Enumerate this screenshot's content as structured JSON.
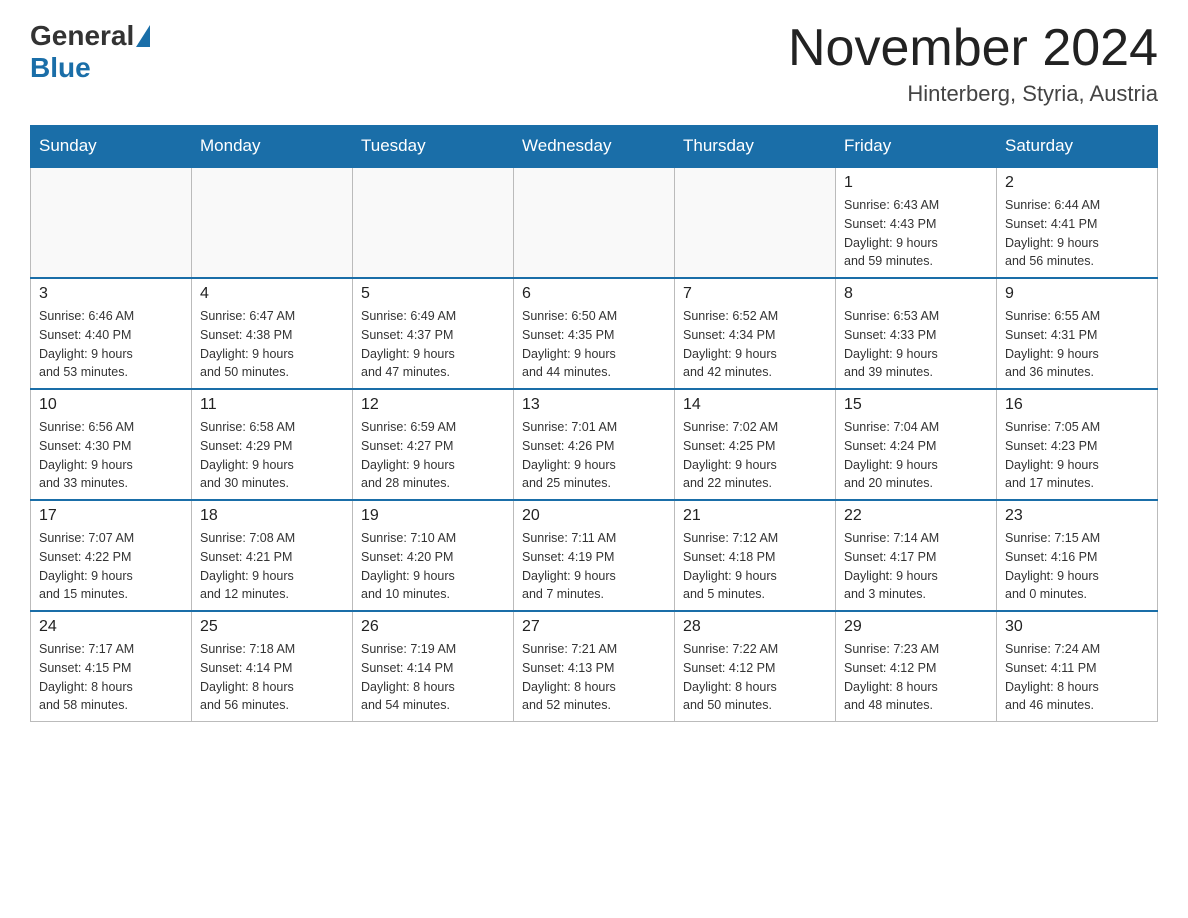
{
  "header": {
    "logo_general": "General",
    "logo_blue": "Blue",
    "month_year": "November 2024",
    "location": "Hinterberg, Styria, Austria"
  },
  "days_of_week": [
    "Sunday",
    "Monday",
    "Tuesday",
    "Wednesday",
    "Thursday",
    "Friday",
    "Saturday"
  ],
  "weeks": [
    [
      {
        "day": "",
        "info": ""
      },
      {
        "day": "",
        "info": ""
      },
      {
        "day": "",
        "info": ""
      },
      {
        "day": "",
        "info": ""
      },
      {
        "day": "",
        "info": ""
      },
      {
        "day": "1",
        "info": "Sunrise: 6:43 AM\nSunset: 4:43 PM\nDaylight: 9 hours\nand 59 minutes."
      },
      {
        "day": "2",
        "info": "Sunrise: 6:44 AM\nSunset: 4:41 PM\nDaylight: 9 hours\nand 56 minutes."
      }
    ],
    [
      {
        "day": "3",
        "info": "Sunrise: 6:46 AM\nSunset: 4:40 PM\nDaylight: 9 hours\nand 53 minutes."
      },
      {
        "day": "4",
        "info": "Sunrise: 6:47 AM\nSunset: 4:38 PM\nDaylight: 9 hours\nand 50 minutes."
      },
      {
        "day": "5",
        "info": "Sunrise: 6:49 AM\nSunset: 4:37 PM\nDaylight: 9 hours\nand 47 minutes."
      },
      {
        "day": "6",
        "info": "Sunrise: 6:50 AM\nSunset: 4:35 PM\nDaylight: 9 hours\nand 44 minutes."
      },
      {
        "day": "7",
        "info": "Sunrise: 6:52 AM\nSunset: 4:34 PM\nDaylight: 9 hours\nand 42 minutes."
      },
      {
        "day": "8",
        "info": "Sunrise: 6:53 AM\nSunset: 4:33 PM\nDaylight: 9 hours\nand 39 minutes."
      },
      {
        "day": "9",
        "info": "Sunrise: 6:55 AM\nSunset: 4:31 PM\nDaylight: 9 hours\nand 36 minutes."
      }
    ],
    [
      {
        "day": "10",
        "info": "Sunrise: 6:56 AM\nSunset: 4:30 PM\nDaylight: 9 hours\nand 33 minutes."
      },
      {
        "day": "11",
        "info": "Sunrise: 6:58 AM\nSunset: 4:29 PM\nDaylight: 9 hours\nand 30 minutes."
      },
      {
        "day": "12",
        "info": "Sunrise: 6:59 AM\nSunset: 4:27 PM\nDaylight: 9 hours\nand 28 minutes."
      },
      {
        "day": "13",
        "info": "Sunrise: 7:01 AM\nSunset: 4:26 PM\nDaylight: 9 hours\nand 25 minutes."
      },
      {
        "day": "14",
        "info": "Sunrise: 7:02 AM\nSunset: 4:25 PM\nDaylight: 9 hours\nand 22 minutes."
      },
      {
        "day": "15",
        "info": "Sunrise: 7:04 AM\nSunset: 4:24 PM\nDaylight: 9 hours\nand 20 minutes."
      },
      {
        "day": "16",
        "info": "Sunrise: 7:05 AM\nSunset: 4:23 PM\nDaylight: 9 hours\nand 17 minutes."
      }
    ],
    [
      {
        "day": "17",
        "info": "Sunrise: 7:07 AM\nSunset: 4:22 PM\nDaylight: 9 hours\nand 15 minutes."
      },
      {
        "day": "18",
        "info": "Sunrise: 7:08 AM\nSunset: 4:21 PM\nDaylight: 9 hours\nand 12 minutes."
      },
      {
        "day": "19",
        "info": "Sunrise: 7:10 AM\nSunset: 4:20 PM\nDaylight: 9 hours\nand 10 minutes."
      },
      {
        "day": "20",
        "info": "Sunrise: 7:11 AM\nSunset: 4:19 PM\nDaylight: 9 hours\nand 7 minutes."
      },
      {
        "day": "21",
        "info": "Sunrise: 7:12 AM\nSunset: 4:18 PM\nDaylight: 9 hours\nand 5 minutes."
      },
      {
        "day": "22",
        "info": "Sunrise: 7:14 AM\nSunset: 4:17 PM\nDaylight: 9 hours\nand 3 minutes."
      },
      {
        "day": "23",
        "info": "Sunrise: 7:15 AM\nSunset: 4:16 PM\nDaylight: 9 hours\nand 0 minutes."
      }
    ],
    [
      {
        "day": "24",
        "info": "Sunrise: 7:17 AM\nSunset: 4:15 PM\nDaylight: 8 hours\nand 58 minutes."
      },
      {
        "day": "25",
        "info": "Sunrise: 7:18 AM\nSunset: 4:14 PM\nDaylight: 8 hours\nand 56 minutes."
      },
      {
        "day": "26",
        "info": "Sunrise: 7:19 AM\nSunset: 4:14 PM\nDaylight: 8 hours\nand 54 minutes."
      },
      {
        "day": "27",
        "info": "Sunrise: 7:21 AM\nSunset: 4:13 PM\nDaylight: 8 hours\nand 52 minutes."
      },
      {
        "day": "28",
        "info": "Sunrise: 7:22 AM\nSunset: 4:12 PM\nDaylight: 8 hours\nand 50 minutes."
      },
      {
        "day": "29",
        "info": "Sunrise: 7:23 AM\nSunset: 4:12 PM\nDaylight: 8 hours\nand 48 minutes."
      },
      {
        "day": "30",
        "info": "Sunrise: 7:24 AM\nSunset: 4:11 PM\nDaylight: 8 hours\nand 46 minutes."
      }
    ]
  ]
}
